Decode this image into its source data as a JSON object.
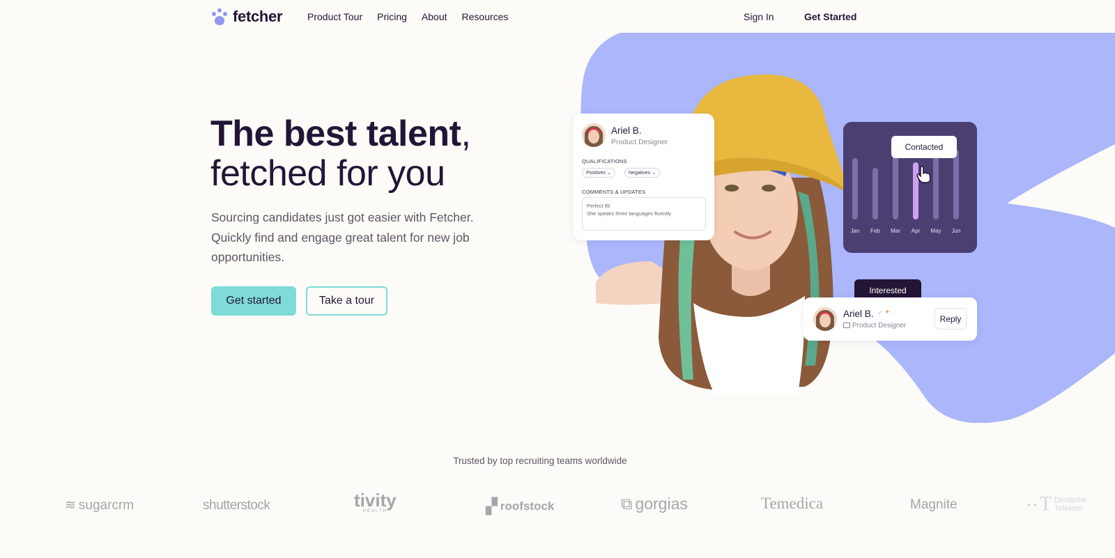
{
  "nav": {
    "logo": "fetcher",
    "links": [
      "Product Tour",
      "Pricing",
      "About",
      "Resources"
    ],
    "sign_in": "Sign In",
    "get_started": "Get Started"
  },
  "hero": {
    "headline_bold": "The best talent",
    "headline_comma": ",",
    "headline_light": "fetched for you",
    "subtext": "Sourcing candidates just got easier with Fetcher. Quickly find and engage great talent for new job opportunities.",
    "primary_cta": "Get started",
    "secondary_cta": "Take a tour"
  },
  "profile_card": {
    "name": "Ariel B.",
    "role": "Product Designer",
    "qualifications_label": "QUALIFICATIONS",
    "chips": [
      "Positives",
      "Negatives"
    ],
    "comments_label": "COMMENTS & UPDATES",
    "comment_line1": "Perfect fit!",
    "comment_line2": "She speaks three languages fluently"
  },
  "chart_card": {
    "tooltip": "Contacted",
    "months": [
      "Jan",
      "Feb",
      "Mar",
      "Apr",
      "May",
      "Jun"
    ],
    "highlight_month": "Apr"
  },
  "reply_card": {
    "status": "Interested",
    "name": "Ariel B.",
    "role": "Product Designer",
    "reply": "Reply"
  },
  "trusted": {
    "caption": "Trusted by top recruiting teams worldwide",
    "brands": [
      "sugarcrm",
      "shutterstock",
      "tivity",
      "HEALTH",
      "roofstock",
      "gorgias",
      "Temedica",
      "Magnite",
      "Deutsche Telekom"
    ]
  },
  "colors": {
    "accent_teal": "#7edbd7",
    "blob_periwinkle": "#abb6fb",
    "chart_purple": "#4b3f72",
    "dark_ink": "#231536"
  }
}
